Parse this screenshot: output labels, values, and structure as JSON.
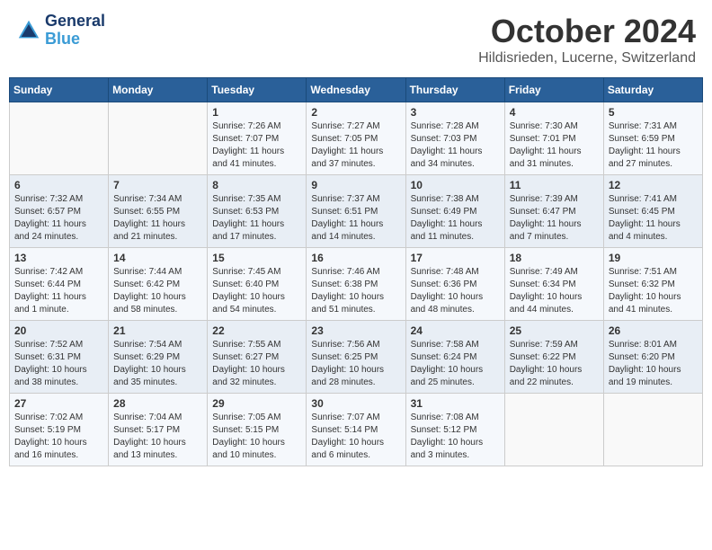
{
  "header": {
    "logo_line1": "General",
    "logo_line2": "Blue",
    "title": "October 2024",
    "location": "Hildisrieden, Lucerne, Switzerland"
  },
  "days_of_week": [
    "Sunday",
    "Monday",
    "Tuesday",
    "Wednesday",
    "Thursday",
    "Friday",
    "Saturday"
  ],
  "weeks": [
    [
      {
        "day": "",
        "info": ""
      },
      {
        "day": "",
        "info": ""
      },
      {
        "day": "1",
        "info": "Sunrise: 7:26 AM\nSunset: 7:07 PM\nDaylight: 11 hours and 41 minutes."
      },
      {
        "day": "2",
        "info": "Sunrise: 7:27 AM\nSunset: 7:05 PM\nDaylight: 11 hours and 37 minutes."
      },
      {
        "day": "3",
        "info": "Sunrise: 7:28 AM\nSunset: 7:03 PM\nDaylight: 11 hours and 34 minutes."
      },
      {
        "day": "4",
        "info": "Sunrise: 7:30 AM\nSunset: 7:01 PM\nDaylight: 11 hours and 31 minutes."
      },
      {
        "day": "5",
        "info": "Sunrise: 7:31 AM\nSunset: 6:59 PM\nDaylight: 11 hours and 27 minutes."
      }
    ],
    [
      {
        "day": "6",
        "info": "Sunrise: 7:32 AM\nSunset: 6:57 PM\nDaylight: 11 hours and 24 minutes."
      },
      {
        "day": "7",
        "info": "Sunrise: 7:34 AM\nSunset: 6:55 PM\nDaylight: 11 hours and 21 minutes."
      },
      {
        "day": "8",
        "info": "Sunrise: 7:35 AM\nSunset: 6:53 PM\nDaylight: 11 hours and 17 minutes."
      },
      {
        "day": "9",
        "info": "Sunrise: 7:37 AM\nSunset: 6:51 PM\nDaylight: 11 hours and 14 minutes."
      },
      {
        "day": "10",
        "info": "Sunrise: 7:38 AM\nSunset: 6:49 PM\nDaylight: 11 hours and 11 minutes."
      },
      {
        "day": "11",
        "info": "Sunrise: 7:39 AM\nSunset: 6:47 PM\nDaylight: 11 hours and 7 minutes."
      },
      {
        "day": "12",
        "info": "Sunrise: 7:41 AM\nSunset: 6:45 PM\nDaylight: 11 hours and 4 minutes."
      }
    ],
    [
      {
        "day": "13",
        "info": "Sunrise: 7:42 AM\nSunset: 6:44 PM\nDaylight: 11 hours and 1 minute."
      },
      {
        "day": "14",
        "info": "Sunrise: 7:44 AM\nSunset: 6:42 PM\nDaylight: 10 hours and 58 minutes."
      },
      {
        "day": "15",
        "info": "Sunrise: 7:45 AM\nSunset: 6:40 PM\nDaylight: 10 hours and 54 minutes."
      },
      {
        "day": "16",
        "info": "Sunrise: 7:46 AM\nSunset: 6:38 PM\nDaylight: 10 hours and 51 minutes."
      },
      {
        "day": "17",
        "info": "Sunrise: 7:48 AM\nSunset: 6:36 PM\nDaylight: 10 hours and 48 minutes."
      },
      {
        "day": "18",
        "info": "Sunrise: 7:49 AM\nSunset: 6:34 PM\nDaylight: 10 hours and 44 minutes."
      },
      {
        "day": "19",
        "info": "Sunrise: 7:51 AM\nSunset: 6:32 PM\nDaylight: 10 hours and 41 minutes."
      }
    ],
    [
      {
        "day": "20",
        "info": "Sunrise: 7:52 AM\nSunset: 6:31 PM\nDaylight: 10 hours and 38 minutes."
      },
      {
        "day": "21",
        "info": "Sunrise: 7:54 AM\nSunset: 6:29 PM\nDaylight: 10 hours and 35 minutes."
      },
      {
        "day": "22",
        "info": "Sunrise: 7:55 AM\nSunset: 6:27 PM\nDaylight: 10 hours and 32 minutes."
      },
      {
        "day": "23",
        "info": "Sunrise: 7:56 AM\nSunset: 6:25 PM\nDaylight: 10 hours and 28 minutes."
      },
      {
        "day": "24",
        "info": "Sunrise: 7:58 AM\nSunset: 6:24 PM\nDaylight: 10 hours and 25 minutes."
      },
      {
        "day": "25",
        "info": "Sunrise: 7:59 AM\nSunset: 6:22 PM\nDaylight: 10 hours and 22 minutes."
      },
      {
        "day": "26",
        "info": "Sunrise: 8:01 AM\nSunset: 6:20 PM\nDaylight: 10 hours and 19 minutes."
      }
    ],
    [
      {
        "day": "27",
        "info": "Sunrise: 7:02 AM\nSunset: 5:19 PM\nDaylight: 10 hours and 16 minutes."
      },
      {
        "day": "28",
        "info": "Sunrise: 7:04 AM\nSunset: 5:17 PM\nDaylight: 10 hours and 13 minutes."
      },
      {
        "day": "29",
        "info": "Sunrise: 7:05 AM\nSunset: 5:15 PM\nDaylight: 10 hours and 10 minutes."
      },
      {
        "day": "30",
        "info": "Sunrise: 7:07 AM\nSunset: 5:14 PM\nDaylight: 10 hours and 6 minutes."
      },
      {
        "day": "31",
        "info": "Sunrise: 7:08 AM\nSunset: 5:12 PM\nDaylight: 10 hours and 3 minutes."
      },
      {
        "day": "",
        "info": ""
      },
      {
        "day": "",
        "info": ""
      }
    ]
  ]
}
